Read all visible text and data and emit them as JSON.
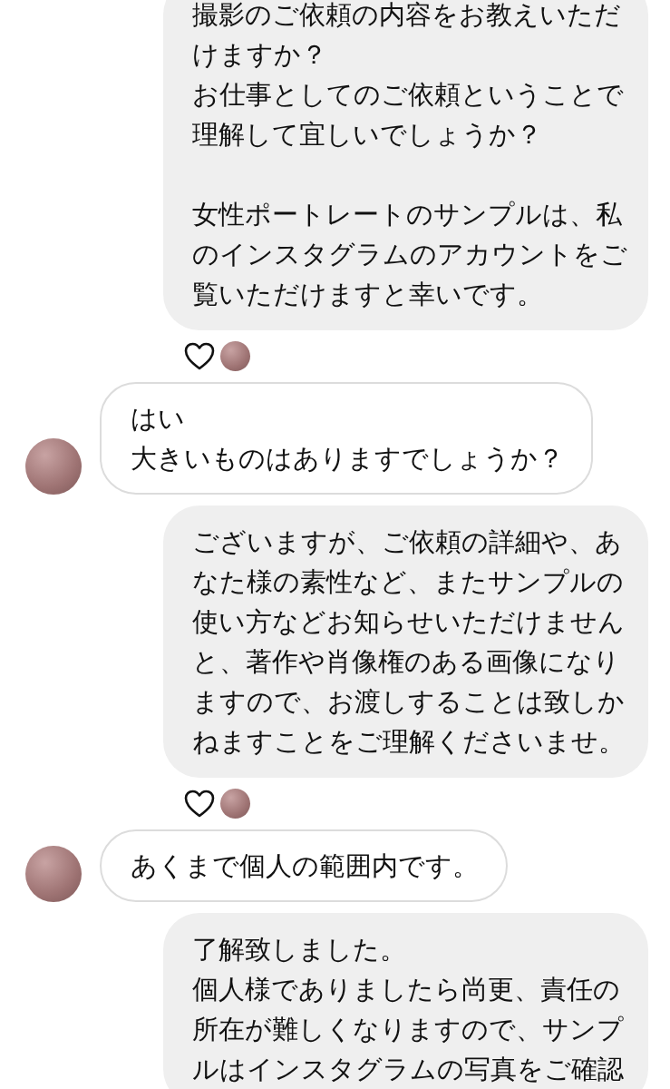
{
  "messages": [
    {
      "kind": "sent",
      "blocks": [
        [
          "撮影のご依頼の内容をお教えいただけますか？",
          "お仕事としてのご依頼ということで理解して宜しいでしょうか？"
        ],
        [
          "女性ポートレートのサンプルは、私のインスタグラムのアカウントをご覧いただけますと幸いです。"
        ]
      ]
    },
    {
      "kind": "reaction"
    },
    {
      "kind": "received",
      "blocks": [
        [
          "はい",
          "大きいものはありますでしょうか？"
        ]
      ]
    },
    {
      "kind": "sent",
      "blocks": [
        [
          "ございますが、ご依頼の詳細や、あなた様の素性など、またサンプルの使い方などお知らせいただけませんと、著作や肖像権のある画像になりますので、お渡しすることは致しかねますことをご理解くださいませ。"
        ]
      ]
    },
    {
      "kind": "reaction"
    },
    {
      "kind": "received",
      "blocks": [
        [
          "あくまで個人の範囲内です。"
        ]
      ]
    },
    {
      "kind": "sent",
      "blocks": [
        [
          "了解致しました。",
          "個人様でありましたら尚更、責任の所在が難しくなりますので、サンプルはインスタグラムの写真をご確認"
        ]
      ]
    }
  ]
}
